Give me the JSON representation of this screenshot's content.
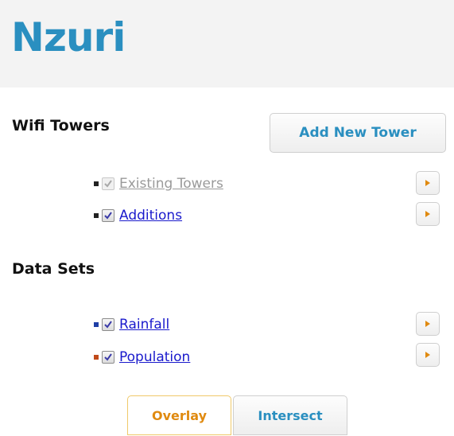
{
  "app": {
    "title": "Nzuri"
  },
  "wifi_towers": {
    "title": "Wifi Towers",
    "add_button": "Add New Tower",
    "layers": [
      {
        "label": "Existing Towers",
        "checked": true,
        "disabled": true,
        "bullet_color": "#222222"
      },
      {
        "label": "Additions",
        "checked": true,
        "disabled": false,
        "bullet_color": "#222222"
      }
    ]
  },
  "data_sets": {
    "title": "Data Sets",
    "layers": [
      {
        "label": "Rainfall",
        "checked": true,
        "disabled": false,
        "bullet_color": "#1f3fa6"
      },
      {
        "label": "Population",
        "checked": true,
        "disabled": false,
        "bullet_color": "#c04a1a"
      }
    ]
  },
  "tabs": [
    {
      "label": "Overlay",
      "active": true
    },
    {
      "label": "Intersect",
      "active": false
    }
  ],
  "colors": {
    "brand": "#2a8fc0",
    "link": "#1a1acc",
    "arrow": "#e08a10",
    "active_tab": "#e08a10"
  },
  "icons": {
    "checkbox": "checkmark-icon",
    "expand": "play-arrow-icon"
  }
}
